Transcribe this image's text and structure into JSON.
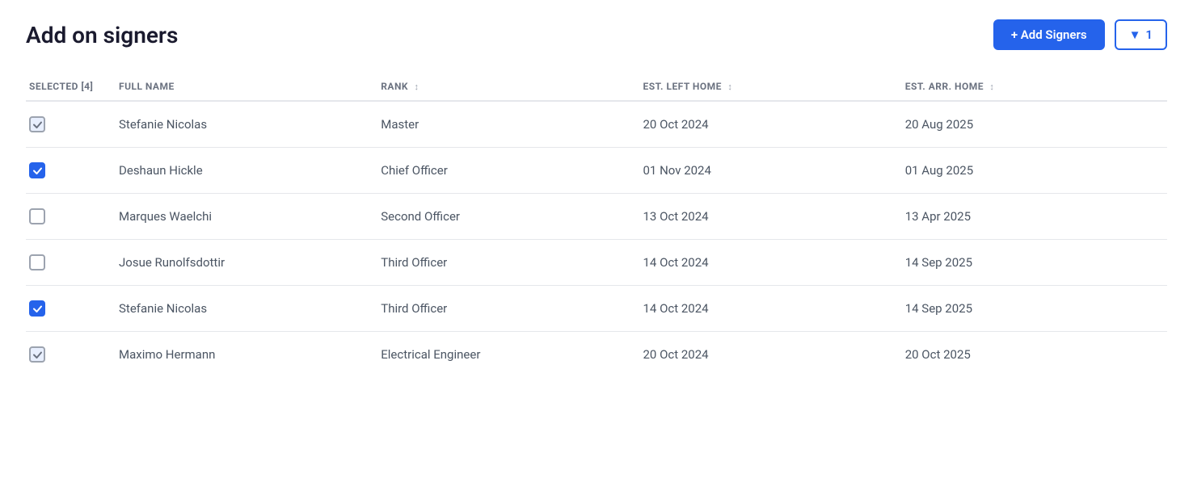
{
  "page": {
    "title": "Add on signers"
  },
  "buttons": {
    "add_signers_label": "+ Add Signers",
    "filter_label": "1"
  },
  "table": {
    "columns": [
      {
        "key": "selected",
        "label": "SELECTED [4]",
        "sortable": false
      },
      {
        "key": "fullname",
        "label": "FULL NAME",
        "sortable": false
      },
      {
        "key": "rank",
        "label": "RANK",
        "sortable": true
      },
      {
        "key": "est_left_home",
        "label": "EST. LEFT HOME",
        "sortable": true
      },
      {
        "key": "est_arr_home",
        "label": "EST. ARR. HOME",
        "sortable": true
      }
    ],
    "rows": [
      {
        "id": 1,
        "checked": "light",
        "fullname": "Stefanie Nicolas",
        "rank": "Master",
        "est_left_home": "20 Oct 2024",
        "est_arr_home": "20 Aug 2025"
      },
      {
        "id": 2,
        "checked": "checked",
        "fullname": "Deshaun Hickle",
        "rank": "Chief Officer",
        "est_left_home": "01 Nov 2024",
        "est_arr_home": "01 Aug 2025"
      },
      {
        "id": 3,
        "checked": "unchecked",
        "fullname": "Marques Waelchi",
        "rank": "Second Officer",
        "est_left_home": "13 Oct 2024",
        "est_arr_home": "13 Apr 2025"
      },
      {
        "id": 4,
        "checked": "unchecked",
        "fullname": "Josue Runolfsdottir",
        "rank": "Third Officer",
        "est_left_home": "14 Oct 2024",
        "est_arr_home": "14 Sep 2025"
      },
      {
        "id": 5,
        "checked": "checked",
        "fullname": "Stefanie Nicolas",
        "rank": "Third Officer",
        "est_left_home": "14 Oct 2024",
        "est_arr_home": "14 Sep 2025"
      },
      {
        "id": 6,
        "checked": "light",
        "fullname": "Maximo Hermann",
        "rank": "Electrical Engineer",
        "est_left_home": "20 Oct 2024",
        "est_arr_home": "20 Oct 2025"
      }
    ]
  }
}
